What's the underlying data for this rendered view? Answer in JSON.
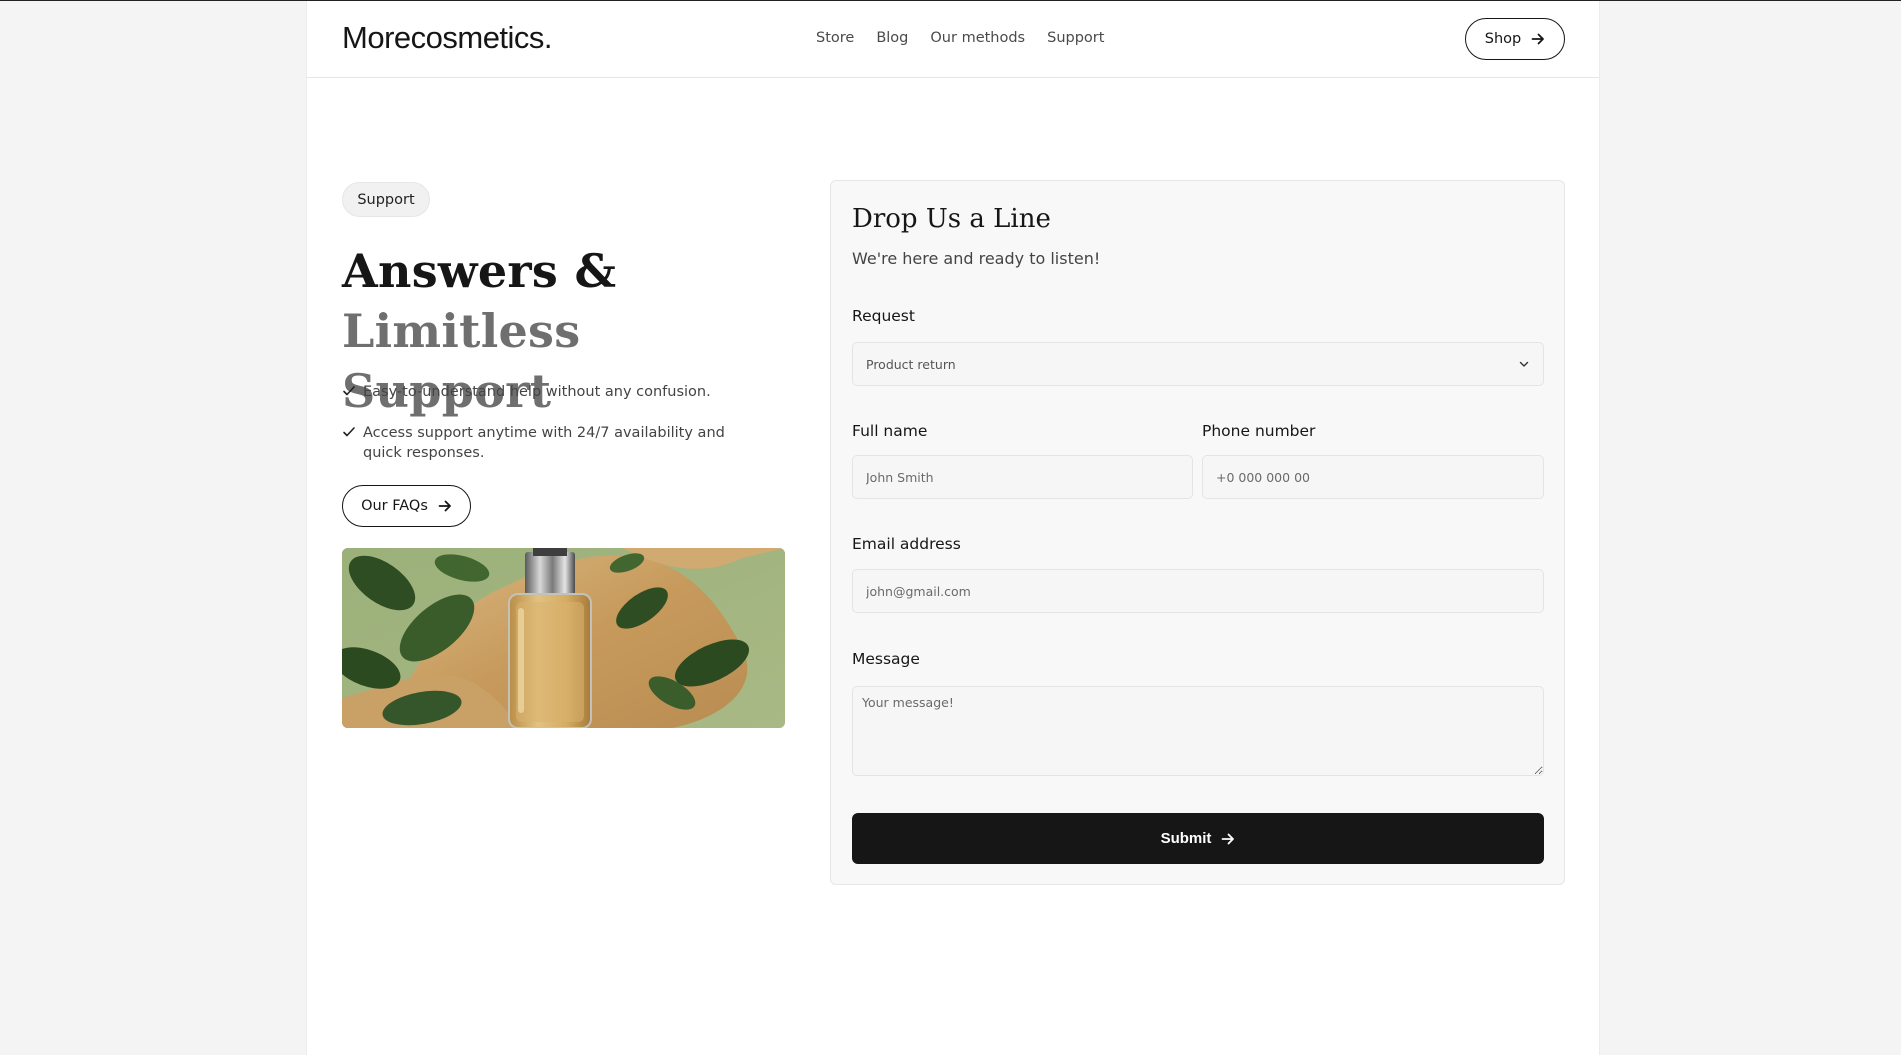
{
  "header": {
    "logo": "Morecosmetics.",
    "nav": [
      "Store",
      "Blog",
      "Our methods",
      "Support"
    ],
    "shop_label": "Shop"
  },
  "hero": {
    "badge": "Support",
    "headline_dark": "Answers & ",
    "headline_muted": "Limitless Support",
    "features": [
      "Easy-to-understand help without any confusion.",
      "Access support anytime with 24/7 availability and quick responses."
    ],
    "faq_label": "Our FAQs"
  },
  "form": {
    "title": "Drop Us a Line",
    "subtitle": "We're here and ready to listen!",
    "request_label": "Request",
    "request_value": "Product return",
    "fullname_label": "Full name",
    "fullname_placeholder": "John Smith",
    "phone_label": "Phone number",
    "phone_placeholder": "+0 000 000 00",
    "email_label": "Email address",
    "email_placeholder": "john@gmail.com",
    "message_label": "Message",
    "message_placeholder": "Your message!",
    "submit_label": "Submit"
  },
  "colors": {
    "primary": "#161616",
    "muted_heading": "#6f6f6f",
    "page_bg": "#f4f4f4",
    "card_bg": "#f8f8f8"
  }
}
